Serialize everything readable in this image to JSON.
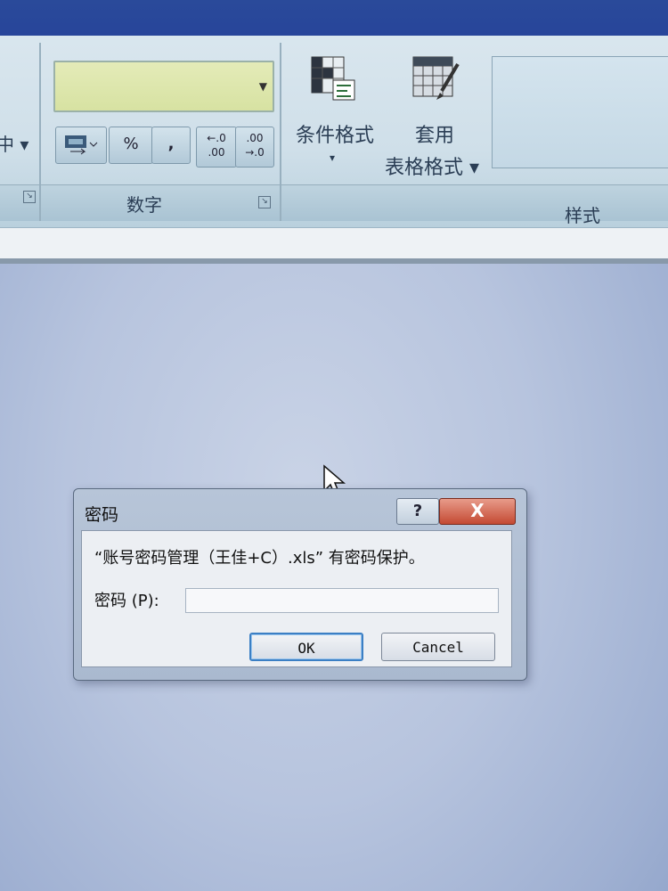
{
  "ribbon": {
    "left_fragment": "中 ▾",
    "number_group": {
      "format_combo_value": "",
      "format_buttons": [
        "%",
        ",",
        "←.0 .00",
        ".00 →.0"
      ],
      "label": "数字"
    },
    "conditional_format": {
      "line1": "条件格式",
      "arrow": "▾"
    },
    "table_format": {
      "line1": "套用",
      "line2": "表格格式 ▾"
    },
    "styles_group_label": "样式"
  },
  "dialog": {
    "title": "密码",
    "help_label": "?",
    "close_label": "X",
    "message": "“账号密码管理（王佳+C）.xls” 有密码保护。",
    "password_label": "密码 (P):",
    "password_value": "",
    "ok_label": "OK",
    "cancel_label": "Cancel"
  },
  "colors": {
    "title_band": "#2a4a9a",
    "close_button": "#c44a33",
    "ok_focus": "#3b7fc4"
  }
}
